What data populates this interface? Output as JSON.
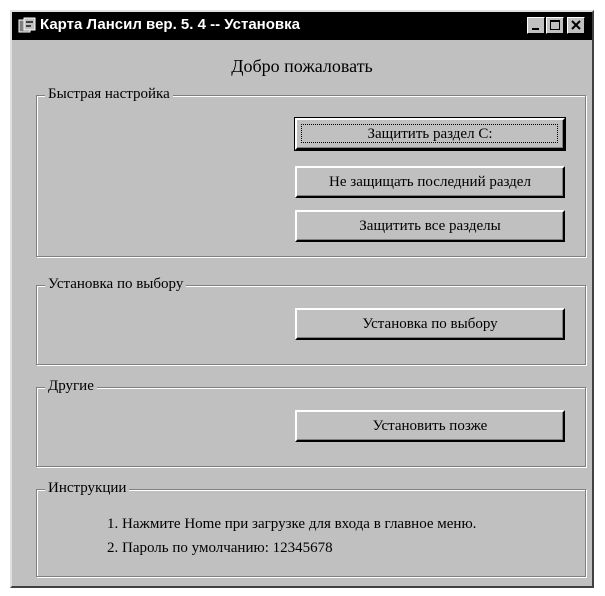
{
  "window": {
    "title": "Карта Лансил вер. 5. 4 -- Установка"
  },
  "welcome": "Добро пожаловать",
  "quick_setup": {
    "legend": "Быстрая настройка",
    "buttons": [
      {
        "label": "Защитить раздел С:"
      },
      {
        "label": "Не защищать последний раздел"
      },
      {
        "label": "Защитить все разделы"
      }
    ]
  },
  "custom_install": {
    "legend": "Установка по выбору",
    "button": "Установка по выбору"
  },
  "other": {
    "legend": "Другие",
    "button": "Установить позже"
  },
  "instructions": {
    "legend": "Инструкции",
    "lines": [
      "1. Нажмите Home при загрузке для входа в главное меню.",
      "2. Пароль по умолчанию:  12345678"
    ]
  },
  "icons": {
    "app": "setup-app-icon",
    "minimize": "minimize-icon",
    "maximize": "maximize-icon",
    "close": "close-icon"
  }
}
